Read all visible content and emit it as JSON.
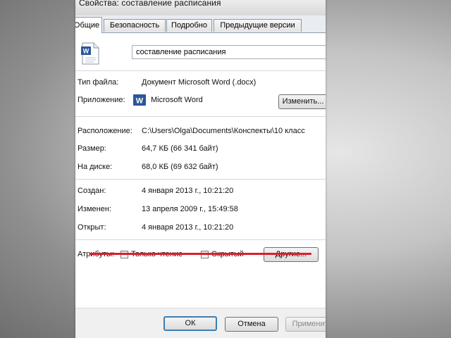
{
  "window": {
    "title": "Свойства: составление расписания"
  },
  "tabs": [
    {
      "label": "Общие"
    },
    {
      "label": "Безопасность"
    },
    {
      "label": "Подробно"
    },
    {
      "label": "Предыдущие версии"
    }
  ],
  "file": {
    "name": "составление расписания",
    "icon": "word-document-icon"
  },
  "type_info": {
    "file_type_label": "Тип файла:",
    "file_type_value": "Документ Microsoft Word (.docx)",
    "app_label": "Приложение:",
    "app_value": "Microsoft Word",
    "change_button": "Изменить..."
  },
  "location_info": {
    "location_label": "Расположение:",
    "location_value": "C:\\Users\\Olga\\Documents\\Конспекты\\10 класс",
    "size_label": "Размер:",
    "size_value": "64,7 КБ (66 341 байт)",
    "disk_label": "На диске:",
    "disk_value": "68,0 КБ (69 632 байт)"
  },
  "dates": {
    "created_label": "Создан:",
    "created_value": "4 января 2013 г., 10:21:20",
    "modified_label": "Изменен:",
    "modified_value": "13 апреля 2009 г., 15:49:58",
    "opened_label": "Открыт:",
    "opened_value": "4 января 2013 г., 10:21:20"
  },
  "attributes": {
    "label": "Атрибуты:",
    "readonly_label": "Только чтение",
    "hidden_label": "Скрытый",
    "other_button": "Другие..."
  },
  "footer": {
    "ok": "ОК",
    "cancel": "Отмена",
    "apply": "Применить"
  },
  "colors": {
    "strike": "#d8202a",
    "ok_border": "#3c7fb1",
    "word_icon": "#2b579a"
  }
}
